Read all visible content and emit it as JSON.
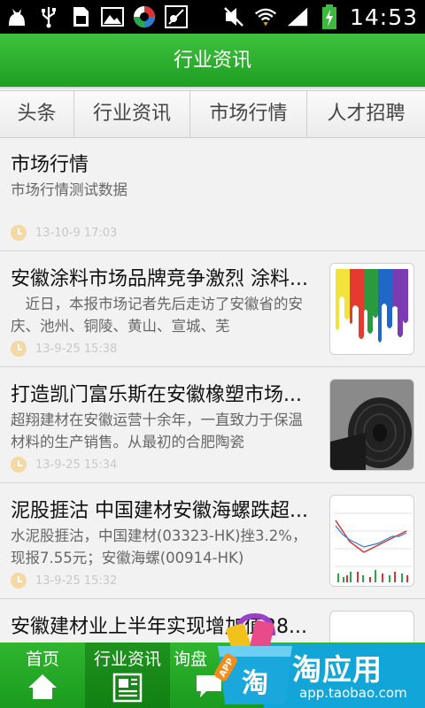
{
  "status_bar": {
    "time": "14:53",
    "left_icons": [
      "cat-icon",
      "usb-icon",
      "sd-card-icon",
      "image-icon",
      "app-icon",
      "mute-icon"
    ],
    "right_icons": [
      "vibrate-off-icon",
      "wifi-icon",
      "signal-icon",
      "battery-charging-icon"
    ]
  },
  "header": {
    "title": "行业资讯"
  },
  "tabs": [
    {
      "label": "头条"
    },
    {
      "label": "行业资讯"
    },
    {
      "label": "市场行情"
    },
    {
      "label": "人才招聘"
    }
  ],
  "articles": [
    {
      "title": "市场行情",
      "summary": "市场行情测试数据",
      "date": "13-10-9 17:03",
      "thumbnail": null
    },
    {
      "title": "安徽涂料市场品牌竞争激烈 涂料...",
      "summary": "　近日，本报市场记者先后走访了安徽省的安庆、池州、铜陵、黄山、宣城、芜",
      "date": "13-9-25 15:38",
      "thumbnail": "paint-drips"
    },
    {
      "title": "打造凯门富乐斯在安徽橡塑市场...",
      "summary": "超翔建材在安徽运营十余年，一直致力于保温材料的生产销售。从最初的合肥陶瓷",
      "date": "13-9-25 15:34",
      "thumbnail": "rubber-rolls"
    },
    {
      "title": "泥股捱沽 中国建材安徽海螺跌超...",
      "summary": "水泥股捱沽，中国建材(03323-HK)挫3.2%，现报7.55元；安徽海螺(00914-HK)",
      "date": "13-9-25 15:32",
      "thumbnail": "stock-chart"
    },
    {
      "title": "安徽建材业上半年实现增加值28...",
      "summary": "",
      "date": "",
      "thumbnail": "blank"
    }
  ],
  "bottom_nav": [
    {
      "label": "首页",
      "icon": "home-icon",
      "active": false
    },
    {
      "label": "行业资讯",
      "icon": "news-icon",
      "active": true
    },
    {
      "label": "询盘",
      "icon": "chat-icon",
      "active": false
    }
  ],
  "promo": {
    "name": "淘应用",
    "url": "app.taobao.com",
    "bag_label": "APP",
    "bag_char": "淘"
  },
  "colors": {
    "header_green": "#2aaf2c",
    "nav_green": "#22a324",
    "promo_blue": "#12a6d8",
    "date_gray": "#c8c8c8"
  }
}
